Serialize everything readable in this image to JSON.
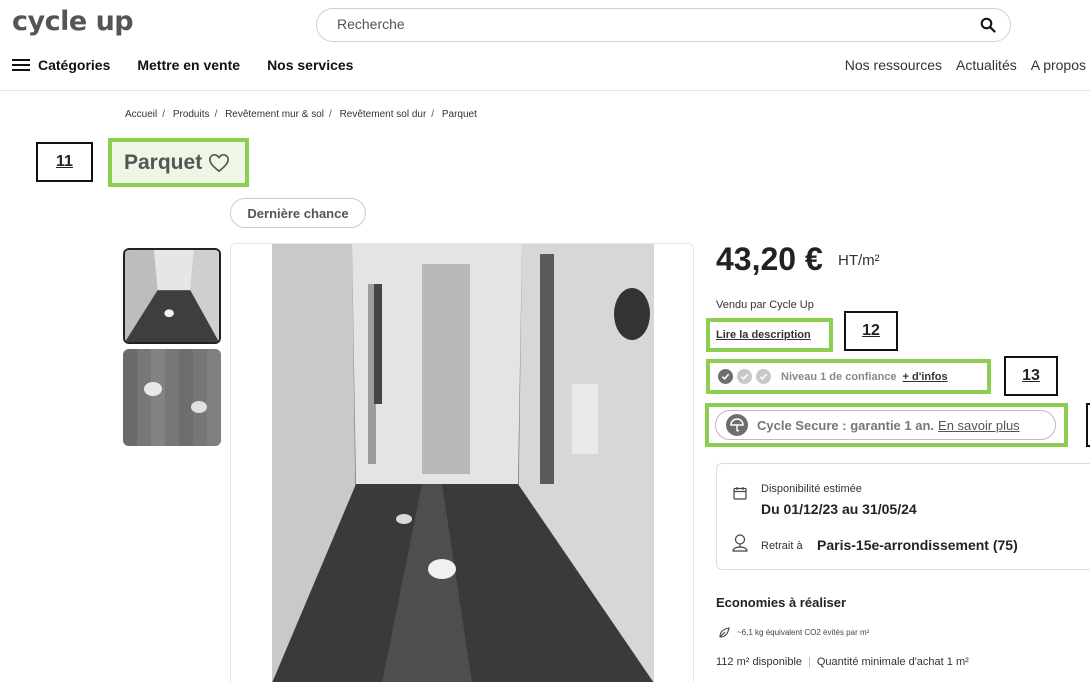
{
  "header": {
    "logo": "cycle up",
    "search_placeholder": "Recherche",
    "search_value": "",
    "nav_left": [
      "Catégories",
      "Mettre en vente",
      "Nos services"
    ],
    "nav_right": [
      "Nos ressources",
      "Actualités",
      "A propos"
    ]
  },
  "breadcrumb": [
    "Accueil",
    "Produits",
    "Revêtement mur & sol",
    "Revêtement sol dur",
    "Parquet"
  ],
  "annotations": {
    "a11": "11",
    "a12": "12",
    "a13": "13"
  },
  "product": {
    "title": "Parquet",
    "badge": "Dernière chance",
    "price": "43,20 €",
    "price_unit": "HT/m²",
    "seller": "Vendu par Cycle Up",
    "description_link": "Lire la description",
    "trust_level": "Niveau 1 de confiance",
    "trust_levels_filled": 1,
    "trust_levels_total": 3,
    "trust_more": "+ d'infos",
    "secure_text": "Cycle Secure : garantie 1 an.",
    "secure_link": "En savoir plus",
    "availability_label": "Disponibilité estimée",
    "availability_dates": "Du 01/12/23 au 31/05/24",
    "pickup_label": "Retrait à",
    "pickup_place": "Paris-15e-arrondissement (75)",
    "eco_title": "Economies à réaliser",
    "co2_text": "~6,1 kg équivalent CO2 évités par m²",
    "available_qty": "112 m² disponible",
    "min_qty": "Quantité minimale d'achat 1 m²"
  },
  "colors": {
    "highlight": "#8ccf50",
    "text": "#222222"
  }
}
